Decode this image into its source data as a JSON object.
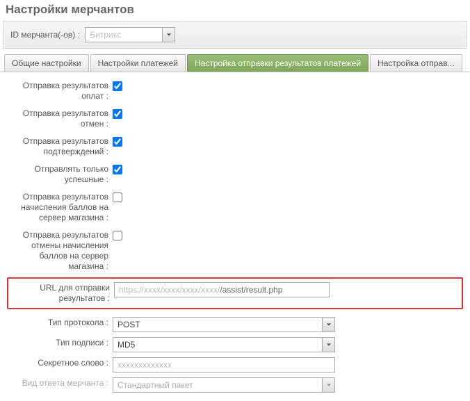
{
  "title": "Настройки мерчантов",
  "id_label": "ID мерчанта(-ов) :",
  "id_value": "Битрикс",
  "tabs": [
    {
      "label": "Общие настройки",
      "active": false
    },
    {
      "label": "Настройки платежей",
      "active": false
    },
    {
      "label": "Настройка отправки результатов платежей",
      "active": true
    },
    {
      "label": "Настройка отправ...",
      "active": false
    }
  ],
  "fields": {
    "send_payment": {
      "label": "Отправка результатов оплат :",
      "checked": true
    },
    "send_cancel": {
      "label": "Отправка результатов отмен :",
      "checked": true
    },
    "send_confirm": {
      "label": "Отправка результатов подтверждений :",
      "checked": true
    },
    "only_success": {
      "label": "Отправлять только успешные :",
      "checked": true
    },
    "send_bonus": {
      "label": "Отправка результатов начисления баллов на сервер магазина :",
      "checked": false
    },
    "send_bonus_cancel": {
      "label": "Отправка результатов отмены начисления баллов на сервер магазина :",
      "checked": false
    },
    "url": {
      "label": "URL для отправки результатов :",
      "value_prefix_obscured": "https://xxxx/xxxx/xxxx/xxxx/",
      "value_suffix": "/assist/result.php"
    },
    "protocol": {
      "label": "Тип протокола :",
      "value": "POST"
    },
    "signature": {
      "label": "Тип подписи :",
      "value": "MD5"
    },
    "secret": {
      "label": "Секретное слово :",
      "value_obscured": "xxxxxxxxxxxxx"
    },
    "response_type": {
      "label": "Вид ответа мерчанта :",
      "value": "Стандартный пакет"
    }
  }
}
